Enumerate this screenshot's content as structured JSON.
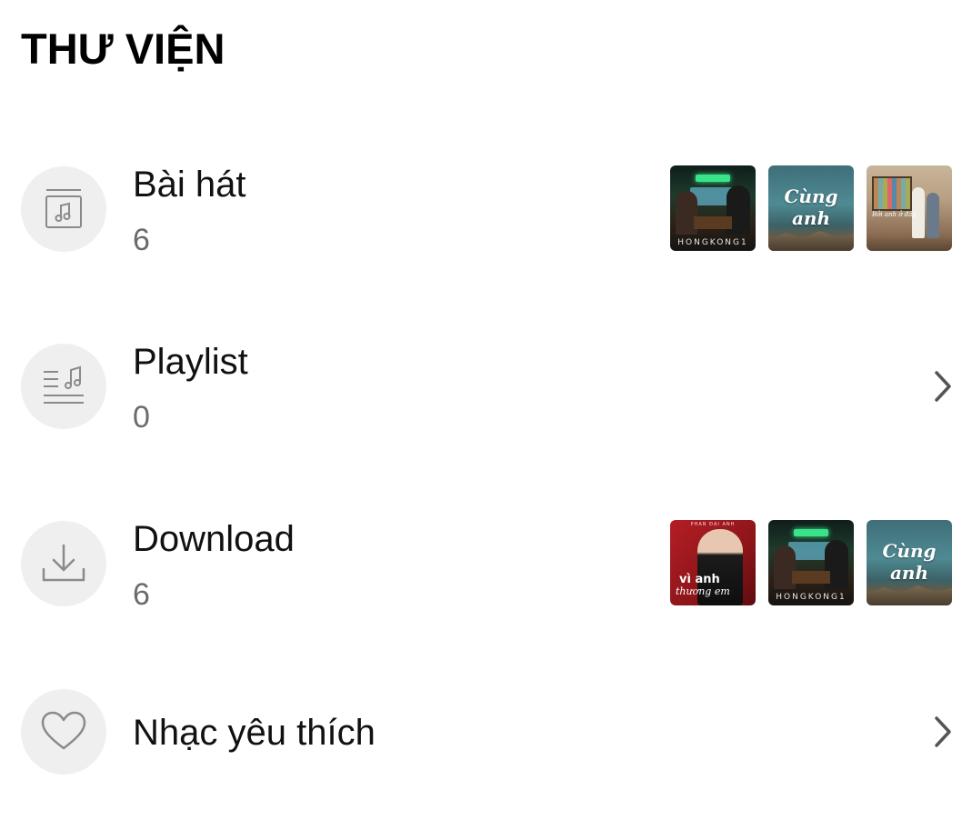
{
  "page": {
    "title": "THƯ VIỆN"
  },
  "library": {
    "items": [
      {
        "label": "Bài hát",
        "count": "6",
        "icon": "music-box-icon",
        "thumbnails": [
          {
            "name": "hongkong1-cover",
            "caption": "HONGKONG1"
          },
          {
            "name": "cung-anh-cover",
            "caption": "Cùng anh"
          },
          {
            "name": "couple-tv-cover",
            "caption": "Bởi anh ở đây"
          }
        ]
      },
      {
        "label": "Playlist",
        "count": "0",
        "icon": "playlist-icon"
      },
      {
        "label": "Download",
        "count": "6",
        "icon": "download-icon",
        "thumbnails": [
          {
            "name": "vi-anh-thuong-em-cover",
            "caption": "vì anh",
            "caption2": "thương em",
            "top": "PHAN ĐẠI ANH"
          },
          {
            "name": "hongkong1-cover",
            "caption": "HONGKONG1"
          },
          {
            "name": "cung-anh-cover",
            "caption": "Cùng anh"
          }
        ]
      },
      {
        "label": "Nhạc yêu thích",
        "icon": "heart-icon"
      }
    ]
  },
  "colors": {
    "icon_circle_bg": "#efefef",
    "icon_stroke": "#8a8a8a",
    "count_text": "#6b6b6b",
    "chevron": "#555555"
  }
}
